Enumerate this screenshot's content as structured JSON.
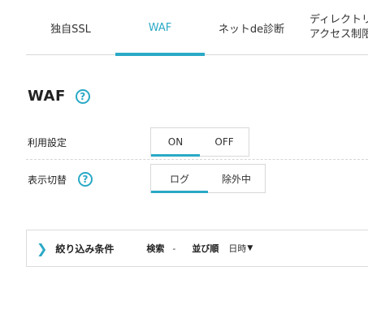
{
  "tabs": [
    {
      "label": "独自SSL"
    },
    {
      "label": "WAF"
    },
    {
      "label": "ネットde診断"
    },
    {
      "label_line1": "ディレクトリ",
      "label_line2": "アクセス制限"
    }
  ],
  "heading": {
    "title": "WAF",
    "help_icon": "question-circle-icon"
  },
  "usage_setting": {
    "label": "利用設定",
    "options": [
      "ON",
      "OFF"
    ],
    "selected": "ON"
  },
  "display_switch": {
    "label": "表示切替",
    "help_icon": "question-circle-icon",
    "options": [
      "ログ",
      "除外中"
    ],
    "selected": "ログ"
  },
  "filter": {
    "chevron_icon": "chevron-right-icon",
    "title": "絞り込み条件",
    "search_label": "検索",
    "search_value": "-",
    "sort_label": "並び順",
    "sort_value": "日時",
    "sort_arrow": "▼"
  },
  "colors": {
    "accent": "#2aa9c6",
    "border": "#d8d8d8"
  }
}
